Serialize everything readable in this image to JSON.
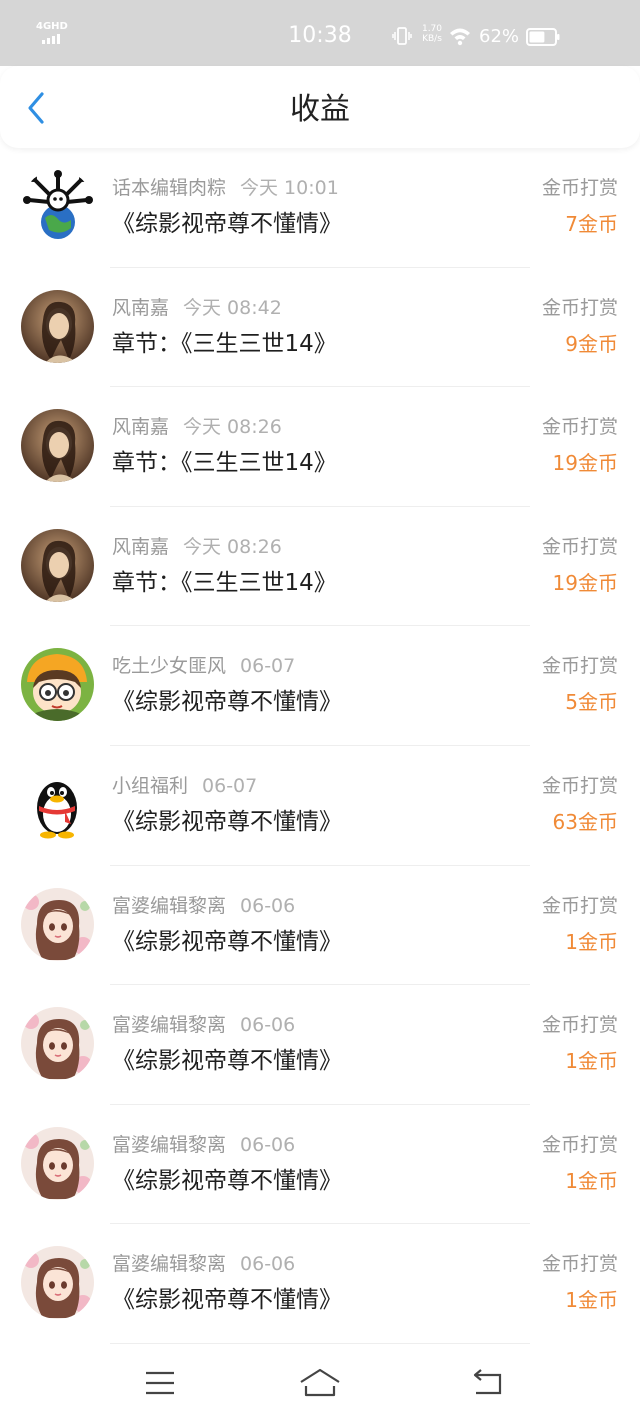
{
  "status_bar": {
    "network": "4GHD",
    "time": "10:38",
    "net_speed_value": "1.70",
    "net_speed_unit": "KB/s",
    "battery_percent": "62%",
    "battery_level": 0.62,
    "icons": [
      "signal-icon",
      "vibrate-icon",
      "wifi-icon",
      "battery-icon"
    ]
  },
  "header": {
    "title": "收益",
    "back_icon": "chevron-left-icon",
    "accent_color": "#2f8fe3"
  },
  "colors": {
    "amount": "#f08a37",
    "meta": "#9a9a9a",
    "status_bar_bg": "#d6d6d6"
  },
  "records": [
    {
      "user": "话本编辑肉粽",
      "time": "今天 10:01",
      "chapter": "《综影视帝尊不懂情》",
      "type": "金币打赏",
      "amount": "7金币",
      "avatar": "bones-globe-avatar"
    },
    {
      "user": "风南嘉",
      "time": "今天 08:42",
      "chapter": "章节：《三生三世14》",
      "type": "金币打赏",
      "amount": "9金币",
      "avatar": "portrait-girl-avatar"
    },
    {
      "user": "风南嘉",
      "time": "今天 08:26",
      "chapter": "章节：《三生三世14》",
      "type": "金币打赏",
      "amount": "19金币",
      "avatar": "portrait-girl-avatar"
    },
    {
      "user": "风南嘉",
      "time": "今天 08:26",
      "chapter": "章节：《三生三世14》",
      "type": "金币打赏",
      "amount": "19金币",
      "avatar": "portrait-girl-avatar"
    },
    {
      "user": "吃土少女匪风",
      "time": "06-07",
      "chapter": "《综影视帝尊不懂情》",
      "type": "金币打赏",
      "amount": "5金币",
      "avatar": "cartoon-glasses-avatar"
    },
    {
      "user": "小组福利",
      "time": "06-07",
      "chapter": "《综影视帝尊不懂情》",
      "type": "金币打赏",
      "amount": "63金币",
      "avatar": "penguin-avatar"
    },
    {
      "user": "富婆编辑黎离",
      "time": "06-06",
      "chapter": "《综影视帝尊不懂情》",
      "type": "金币打赏",
      "amount": "1金币",
      "avatar": "anime-girl-avatar"
    },
    {
      "user": "富婆编辑黎离",
      "time": "06-06",
      "chapter": "《综影视帝尊不懂情》",
      "type": "金币打赏",
      "amount": "1金币",
      "avatar": "anime-girl-avatar"
    },
    {
      "user": "富婆编辑黎离",
      "time": "06-06",
      "chapter": "《综影视帝尊不懂情》",
      "type": "金币打赏",
      "amount": "1金币",
      "avatar": "anime-girl-avatar"
    },
    {
      "user": "富婆编辑黎离",
      "time": "06-06",
      "chapter": "《综影视帝尊不懂情》",
      "type": "金币打赏",
      "amount": "1金币",
      "avatar": "anime-girl-avatar"
    }
  ],
  "nav_bar": {
    "icons": [
      "menu-icon",
      "home-icon",
      "back-icon"
    ]
  }
}
